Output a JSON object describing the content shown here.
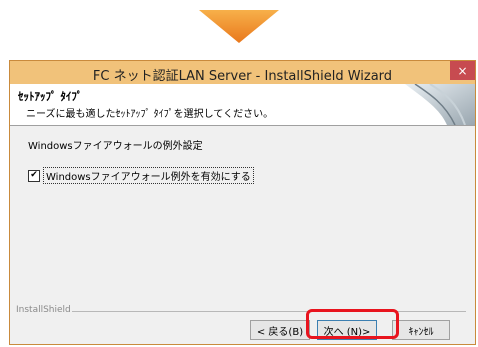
{
  "window": {
    "title": "FC ネット認証LAN Server - InstallShield Wizard",
    "close_glyph": "×"
  },
  "header": {
    "title": "ｾｯﾄｱｯﾌﾟ ﾀｲﾌﾟ",
    "subtitle": "ニーズに最も適したｾｯﾄｱｯﾌﾟ ﾀｲﾌﾟを選択してください。"
  },
  "content": {
    "section_label": "Windowsファイアウォールの例外設定",
    "checkbox": {
      "label": "Windowsファイアウォール例外を有効にする",
      "checked": true,
      "check_glyph": "✔"
    }
  },
  "footer": {
    "brand": "InstallShield",
    "buttons": {
      "back": "< 戻る(B)",
      "next": "次へ (N)>",
      "cancel": "ｷｬﾝｾﾙ"
    }
  },
  "colors": {
    "step_arrow": "#f08c1e",
    "titlebar": "#f1c27a",
    "close": "#c74b50",
    "highlight": "#e8141e"
  }
}
